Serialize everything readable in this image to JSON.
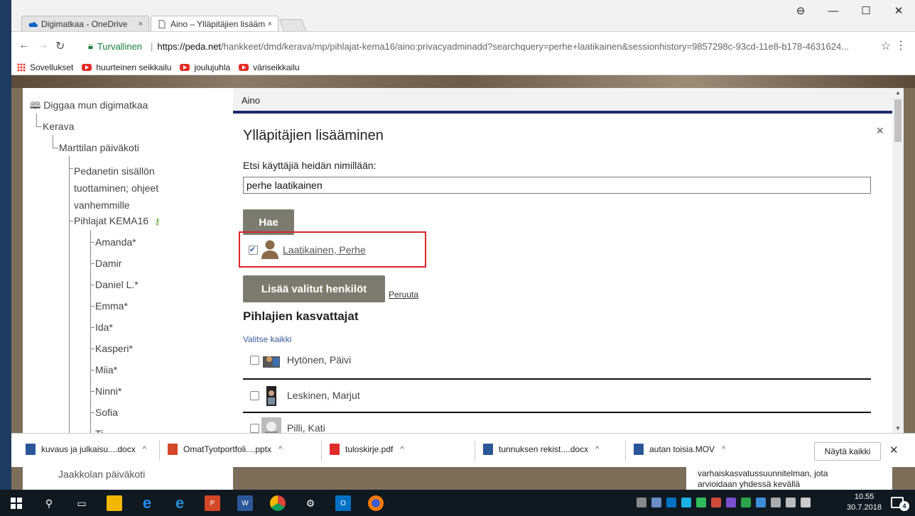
{
  "browser": {
    "tabs": [
      {
        "label": "Digimatkaa - OneDrive",
        "close": "×"
      },
      {
        "label": "Aino – Ylläpitäjien lisääm",
        "close": "×"
      }
    ],
    "window_controls": {
      "user": "⊖",
      "minimize": "—",
      "maximize": "☐",
      "close": "✕"
    },
    "security_label": "Turvallinen",
    "url_host": "https://peda.net",
    "url_path": "/hankkeet/dmd/kerava/mp/pihlajat-kema16/aino:privacyadminadd?searchquery=perhe+laatikainen&sessionhistory=9857298c-93cd-11e8-b178-4631624...",
    "bookmarks": [
      {
        "label": "Sovellukset",
        "icon": "apps-icon"
      },
      {
        "label": "huurteinen seikkailu",
        "icon": "youtube-icon"
      },
      {
        "label": "joulujuhla",
        "icon": "youtube-icon"
      },
      {
        "label": "väriseikkailu",
        "icon": "youtube-icon"
      }
    ]
  },
  "sidebar": {
    "root": "Diggaa mun digimatkaa",
    "level1": "Kerava",
    "level2": "Marttilan päiväkoti",
    "level3_lines": [
      "Pedanetin sisällön",
      "tuottaminen; ohjeet",
      "vanhemmille"
    ],
    "group": "Pihlajat KEMA16",
    "children": [
      "Amanda*",
      "Damir",
      "Daniel L.*",
      "Emma*",
      "Ida*",
      "Kasperi*",
      "Miia*",
      "Ninni*",
      "Sofia",
      "Ti..."
    ],
    "bottom_item": "Jaakkolan päiväkoti"
  },
  "main": {
    "page_header": "Aino",
    "dialog": {
      "title": "Ylläpitäjien lisääminen",
      "close": "×",
      "search_label": "Etsi käyttäjiä heidän nimillään:",
      "search_value": "perhe laatikainen",
      "search_button": "Hae",
      "result_name": "Laatikainen, Perhe",
      "result_checked": true,
      "add_button": "Lisää valitut henkilöt",
      "cancel_link": "Peruuta",
      "group_title": "Pihlajien kasvattajat",
      "select_all": "Valitse kaikki",
      "members": [
        "Hytönen, Päivi",
        "Leskinen, Marjut",
        "Pilli, Kati"
      ]
    },
    "right_snippet_lines": [
      "varhaiskasvatussuunnitelman, jota",
      "arvioidaan yhdessä kevällä"
    ]
  },
  "downloads": {
    "items": [
      {
        "name": "kuvaus ja julkaisu....docx",
        "type": "word",
        "color": "#2b579a"
      },
      {
        "name": "OmatTyotportfoli....pptx",
        "type": "powerpoint",
        "color": "#d24726"
      },
      {
        "name": "tuloskirje.pdf",
        "type": "pdf",
        "color": "#e02b2b"
      },
      {
        "name": "tunnuksen rekist....docx",
        "type": "word",
        "color": "#2b579a"
      },
      {
        "name": "autan toisia.MOV",
        "type": "video",
        "color": "#2b579a"
      }
    ],
    "show_all": "Näytä kaikki",
    "close": "✕"
  },
  "taskbar": {
    "time": "10.55",
    "date": "30.7.2018",
    "notifications": "4"
  }
}
